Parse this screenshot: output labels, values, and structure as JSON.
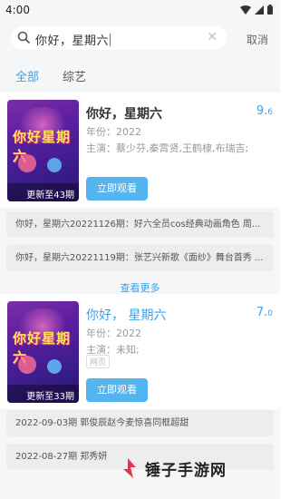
{
  "status": {
    "time": "4:00"
  },
  "search": {
    "query": "你好，星期六",
    "cancel_label": "取消"
  },
  "tabs": [
    {
      "label": "全部",
      "active": true
    },
    {
      "label": "综艺",
      "active": false
    }
  ],
  "results": [
    {
      "title": "你好，星期六",
      "score_main": "9.",
      "score_decimal": "6",
      "year": "年份：2022",
      "cast": "主演：蔡少芬,秦霄贤,王鹤棣,布瑞吉;",
      "tag": "",
      "poster_title": "你好星期六",
      "poster_update": "更新至43期",
      "watch_label": "立即观看",
      "episodes": [
        "你好，星期六20221126期：好六全员cos经典动画角色 周...",
        "你好，星期六20221119期：张艺兴新歌《面纱》舞台首秀 ..."
      ]
    },
    {
      "title": "你好，  星期六",
      "score_main": "7.",
      "score_decimal": "0",
      "year": "年份：2022",
      "cast": "主演：未知;",
      "tag": "网页",
      "poster_title": "你好星期六",
      "poster_update": "更新至33期",
      "watch_label": "立即观看",
      "episodes": [
        "2022-09-03期 郭俊辰赵今麦惊喜同框超甜",
        "2022-08-27期 郑秀妍"
      ]
    }
  ],
  "more_label": "查看更多",
  "watermark": {
    "text": "锤子手游网"
  },
  "colors": {
    "accent": "#3ba1ea",
    "button": "#54b4f0",
    "background": "#f5f6f8"
  }
}
